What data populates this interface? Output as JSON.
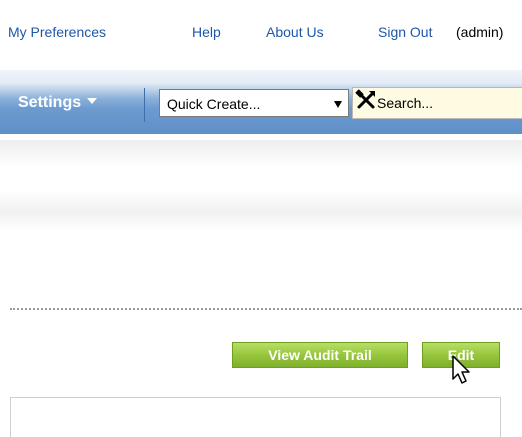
{
  "top_links": {
    "my_preferences": "My Preferences",
    "help": "Help",
    "about_us": "About Us",
    "sign_out": "Sign Out",
    "user": "(admin)"
  },
  "navbar": {
    "settings_label": "Settings",
    "quick_create_label": "Quick Create...",
    "search_placeholder": "Search..."
  },
  "actions": {
    "view_audit_trail": "View Audit Trail",
    "edit": "Edit"
  },
  "colors": {
    "link": "#1f57a8",
    "nav_bar": "#6d9bd0",
    "button_green": "#97c63d",
    "search_bg": "#fffbe2"
  },
  "icons": [
    "tools-icon",
    "dropdown-arrow-icon",
    "caret-down-icon",
    "mouse-cursor-icon"
  ]
}
